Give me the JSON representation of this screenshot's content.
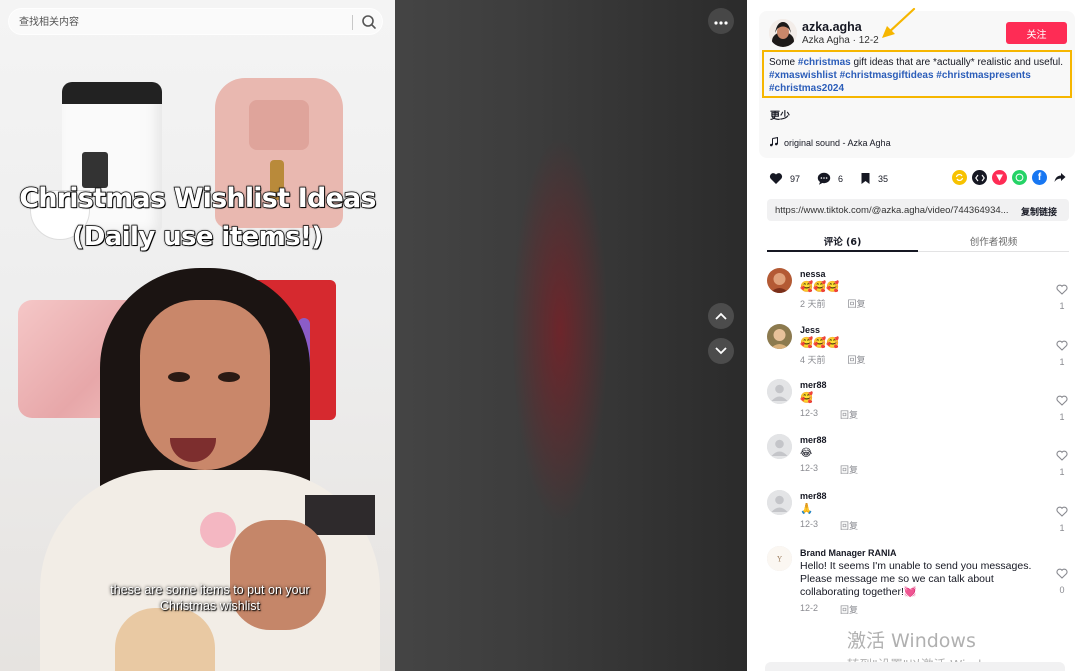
{
  "search": {
    "placeholder": "查找相关内容"
  },
  "video": {
    "overlay_title_line1": "Christmas Wishlist Ideas",
    "overlay_title_line2": "(Daily use items!)",
    "caption": "these are some items to put on your Christmas wishlist"
  },
  "author": {
    "username": "azka.agha",
    "display_name": "Azka Agha",
    "date": "12-2",
    "follow_label": "关注"
  },
  "description": {
    "text_before": "Some ",
    "tag1": "#christmas",
    "text_middle": " gift ideas that are *actually* realistic and useful. ",
    "tags_rest": "#xmaswishlist #christmasgiftideas #christmaspresents #christmas2024",
    "more_label": "更少"
  },
  "music": {
    "label": "original sound - Azka Agha"
  },
  "stats": {
    "likes": "97",
    "comments": "6",
    "saves": "35"
  },
  "share": {
    "url": "https://www.tiktok.com/@azka.agha/video/744364934...",
    "copy_label": "复制链接"
  },
  "tabs": [
    {
      "label": "评论 (6)"
    },
    {
      "label": "创作者视频"
    }
  ],
  "comments": [
    {
      "user": "nessa",
      "text": "🥰🥰🥰",
      "time": "2 天前",
      "reply": "回复",
      "likes": "1"
    },
    {
      "user": "Jess",
      "text": "🥰🥰🥰",
      "time": "4 天前",
      "reply": "回复",
      "likes": "1"
    },
    {
      "user": "mer88",
      "text": "🥰",
      "time": "12-3",
      "reply": "回复",
      "likes": "1"
    },
    {
      "user": "mer88",
      "text": "😂",
      "time": "12-3",
      "reply": "回复",
      "likes": "1"
    },
    {
      "user": "mer88",
      "text": "🙏",
      "time": "12-3",
      "reply": "回复",
      "likes": "1"
    },
    {
      "user": "Brand Manager RANIA",
      "text": "Hello! It seems I'm unable to send you messages. Please message me so we can talk about collaborating together!💓",
      "time": "12-2",
      "reply": "回复",
      "likes": "0"
    }
  ],
  "watermark": {
    "line1": "激活 Windows",
    "line2": "转到\"设置\"以激活 Windows。"
  },
  "colors": {
    "accent_red": "#fe2c55",
    "highlight_yellow": "#f6b600",
    "hashtag_blue": "#2b5db9"
  }
}
